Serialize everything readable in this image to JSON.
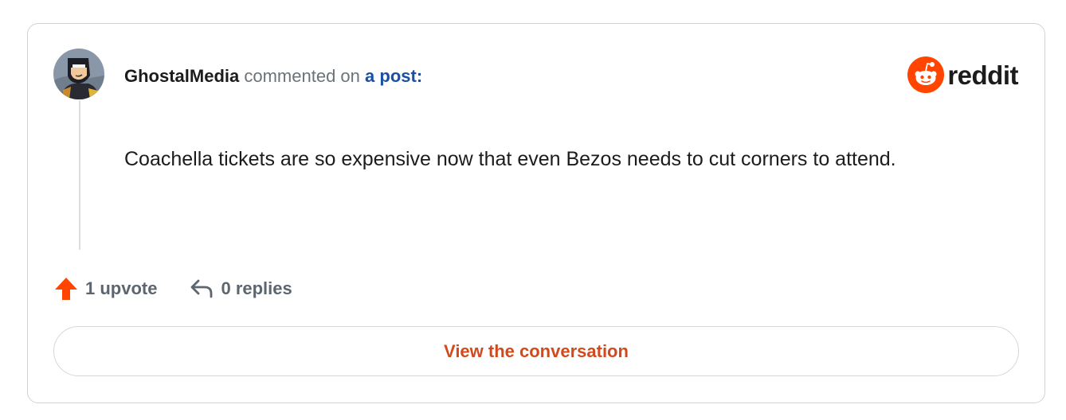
{
  "comment": {
    "author": "GhostalMedia",
    "action_text": "commented on",
    "post_link": "a post:",
    "body": "Coachella tickets are so expensive now that even Bezos needs to cut corners to attend."
  },
  "brand": {
    "name": "reddit",
    "icon": "reddit-snoo-icon",
    "color": "#ff4500"
  },
  "stats": {
    "upvotes": "1 upvote",
    "replies": "0 replies",
    "upvote_icon": "upvote-arrow-icon",
    "reply_icon": "reply-arrow-icon",
    "upvote_color": "#ff4500"
  },
  "cta": {
    "label": "View the conversation",
    "color": "#d24a1b"
  },
  "avatar": {
    "icon": "user-avatar-icon"
  }
}
